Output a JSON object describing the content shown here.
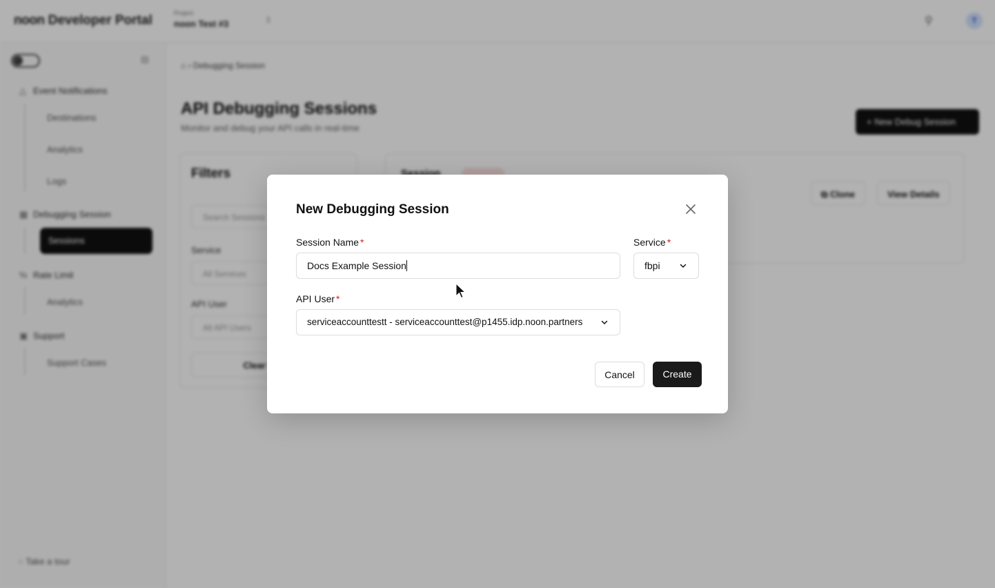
{
  "header": {
    "brand_logo": "noon",
    "brand_suffix": "Developer Portal",
    "project_label": "Project",
    "project_value": "noon Test #3",
    "avatar_initial": "T"
  },
  "sidebar": {
    "groups": [
      {
        "label": "Event Notifications",
        "items": [
          "Destinations",
          "Analytics",
          "Logs"
        ]
      },
      {
        "label": "Debugging Session",
        "items": [
          "Sessions"
        ]
      },
      {
        "label": "Rate Limit",
        "items": [
          "Analytics"
        ]
      },
      {
        "label": "Support",
        "items": [
          "Support Cases"
        ]
      }
    ],
    "tour_label": "Take a tour"
  },
  "main": {
    "breadcrumb": "Debugging Session",
    "title": "API Debugging Sessions",
    "subtitle": "Monitor and debug your API calls in real-time",
    "new_session_button": "+ New Debug Session",
    "filters": {
      "title": "Filters",
      "search_placeholder": "Search Sessions",
      "service_label": "Service",
      "service_value": "All Services",
      "api_user_label": "API User",
      "api_user_value": "All API Users",
      "clear_button": "Clear Filters"
    },
    "card": {
      "title": "Session",
      "clone_button": "Clone",
      "details_button": "View Details"
    }
  },
  "modal": {
    "title": "New Debugging Session",
    "session_name": {
      "label": "Session Name",
      "required": "*",
      "value": "Docs Example Session"
    },
    "service": {
      "label": "Service",
      "required": "*",
      "value": "fbpi"
    },
    "api_user": {
      "label": "API User",
      "required": "*",
      "value": "serviceaccounttestt - serviceaccounttest@p1455.idp.noon.partners"
    },
    "cancel_label": "Cancel",
    "create_label": "Create"
  },
  "colors": {
    "required": "#d42020",
    "primary": "#1a1a1a"
  }
}
